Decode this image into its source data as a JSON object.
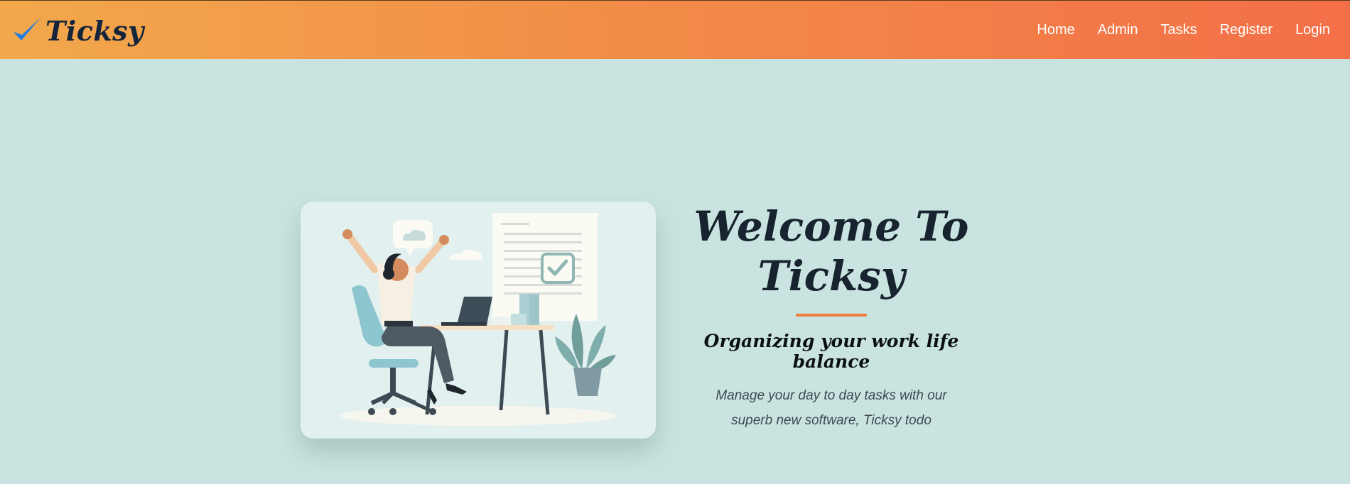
{
  "header": {
    "brand": "Ticksy",
    "nav": [
      {
        "label": "Home"
      },
      {
        "label": "Admin"
      },
      {
        "label": "Tasks"
      },
      {
        "label": "Register"
      },
      {
        "label": "Login"
      }
    ]
  },
  "hero": {
    "title_line1": "Welcome To",
    "title_line2": "Ticksy",
    "subtitle": "Organizing your work life balance",
    "description_line1": "Manage your day to day tasks with our",
    "description_line2": "superb new software, Ticksy todo",
    "illustration_icon": "woman-celebrating-at-desk-illustration"
  },
  "colors": {
    "header_start": "#f2a84b",
    "header_end": "#f36f48",
    "page_bg": "#c9e4e0",
    "accent": "#f07a3a",
    "check_blue": "#1e7fe0"
  }
}
